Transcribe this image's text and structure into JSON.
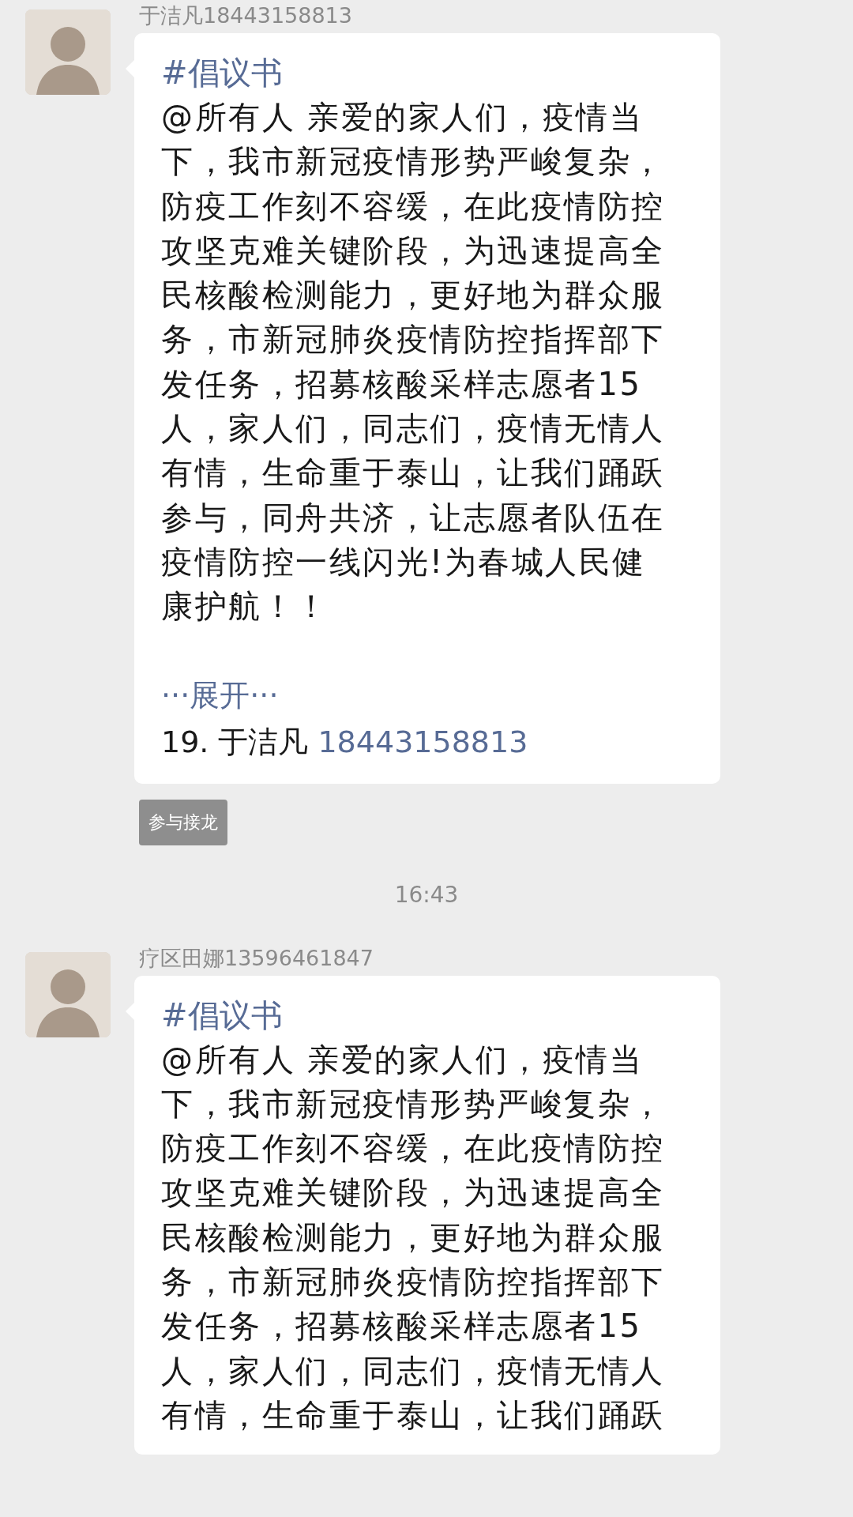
{
  "chat": [
    {
      "kind": "message",
      "sender": "于洁凡18443158813",
      "title": "#倡议书",
      "body": "@所有人 亲爱的家人们，疫情当下，我市新冠疫情形势严峻复杂，防疫工作刻不容缓，在此疫情防控攻坚克难关键阶段，为迅速提高全民核酸检测能力，更好地为群众服务，市新冠肺炎疫情防控指挥部下发任务，招募核酸采样志愿者15人，家人们，同志们，疫情无情人有情，生命重于泰山，让我们踊跃参与，同舟共济，让志愿者队伍在疫情防控一线闪光!为春城人民健康护航！！",
      "expand": "···展开···",
      "entry": {
        "number": "19.",
        "name": "于洁凡",
        "phone": "18443158813"
      },
      "action": "参与接龙"
    },
    {
      "kind": "time",
      "text": "16:43"
    },
    {
      "kind": "message",
      "sender": "疗区田娜13596461847",
      "title": "#倡议书",
      "body": "@所有人 亲爱的家人们，疫情当下，我市新冠疫情形势严峻复杂，防疫工作刻不容缓，在此疫情防控攻坚克难关键阶段，为迅速提高全民核酸检测能力，更好地为群众服务，市新冠肺炎疫情防控指挥部下发任务，招募核酸采样志愿者15人，家人们，同志们，疫情无情人有情，生命重于泰山，让我们踊跃"
    }
  ]
}
